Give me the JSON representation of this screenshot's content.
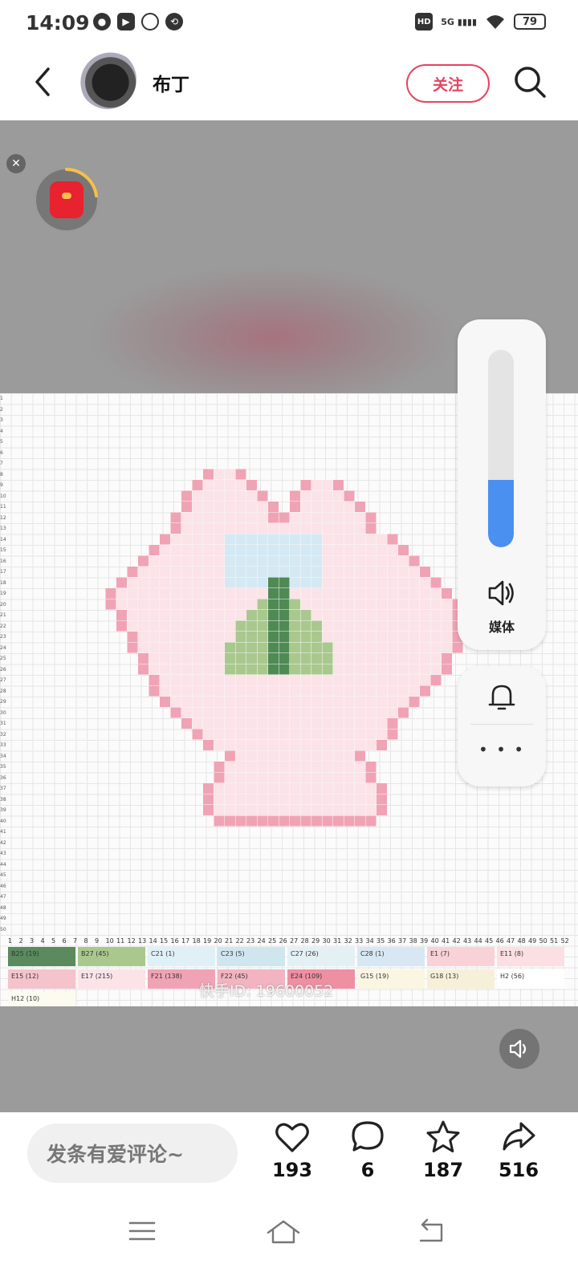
{
  "status": {
    "time": "14:09",
    "hd": "HD",
    "network": "5G",
    "battery": "79"
  },
  "header": {
    "author": "布丁",
    "follow_label": "关注"
  },
  "video": {
    "watermark": "快手ID: 19600052",
    "progress_segments": 24,
    "progress_done": 11,
    "volume_level": 0.34,
    "volume_label": "媒体",
    "more_dots": "• • •",
    "close_glyph": "✕"
  },
  "pattern": {
    "rows": [
      "1",
      "2",
      "3",
      "4",
      "5",
      "6",
      "7",
      "8",
      "9",
      "10",
      "11",
      "12",
      "13",
      "14",
      "15",
      "16",
      "17",
      "18",
      "19",
      "20",
      "21",
      "22",
      "23",
      "24",
      "25",
      "26",
      "27",
      "28",
      "29",
      "30",
      "31",
      "32",
      "33",
      "34",
      "35",
      "36",
      "37",
      "38",
      "39",
      "40",
      "41",
      "42",
      "43",
      "44",
      "45",
      "46",
      "47",
      "48",
      "49",
      "50"
    ],
    "cols": [
      "1",
      "2",
      "3",
      "4",
      "5",
      "6",
      "7",
      "8",
      "9",
      "10",
      "11",
      "12",
      "13",
      "14",
      "15",
      "16",
      "17",
      "18",
      "19",
      "20",
      "21",
      "22",
      "23",
      "24",
      "25",
      "26",
      "27",
      "28",
      "29",
      "30",
      "31",
      "32",
      "33",
      "34",
      "35",
      "36",
      "37",
      "38",
      "39",
      "40",
      "41",
      "42",
      "43",
      "44",
      "45",
      "46",
      "47",
      "48",
      "49",
      "50",
      "51",
      "52"
    ],
    "legend": [
      {
        "label": "B25  (19)",
        "color": "#5a8a5e"
      },
      {
        "label": "B27  (45)",
        "color": "#a9c88e"
      },
      {
        "label": "C21  (1)",
        "color": "#dff0f6"
      },
      {
        "label": "C23  (5)",
        "color": "#cfe6ef"
      },
      {
        "label": "C27  (26)",
        "color": "#e3f1f5"
      },
      {
        "label": "C28  (1)",
        "color": "#d7e8f4"
      },
      {
        "label": "E1  (7)",
        "color": "#f8d2d6"
      },
      {
        "label": "E11  (8)",
        "color": "#fbdfe2"
      },
      {
        "label": "E15  (12)",
        "color": "#f4c3cc"
      },
      {
        "label": "E17  (215)",
        "color": "#fbe3e8"
      },
      {
        "label": "F21  (138)",
        "color": "#f0a3b4"
      },
      {
        "label": "F22  (45)",
        "color": "#f2b4c1"
      },
      {
        "label": "E24  (109)",
        "color": "#ee8fa2"
      },
      {
        "label": "G15  (19)",
        "color": "#fbf6e2"
      },
      {
        "label": "G18  (13)",
        "color": "#f7f0d8"
      },
      {
        "label": "H2  (56)",
        "color": "#ffffff"
      },
      {
        "label": "H12  (10)",
        "color": "#fcfbf0"
      }
    ]
  },
  "bottom": {
    "comment_placeholder": "发条有爱评论~",
    "likes": "193",
    "comments": "6",
    "favorites": "187",
    "shares": "516"
  },
  "colors": {
    "accent": "#e8435f",
    "volume_fill": "#4a90f0",
    "pink": "#f0a3b4",
    "light_pink": "#fbe3e8",
    "green": "#4f8a55",
    "light_green": "#a9c88e",
    "blue": "#d4e9f3"
  }
}
